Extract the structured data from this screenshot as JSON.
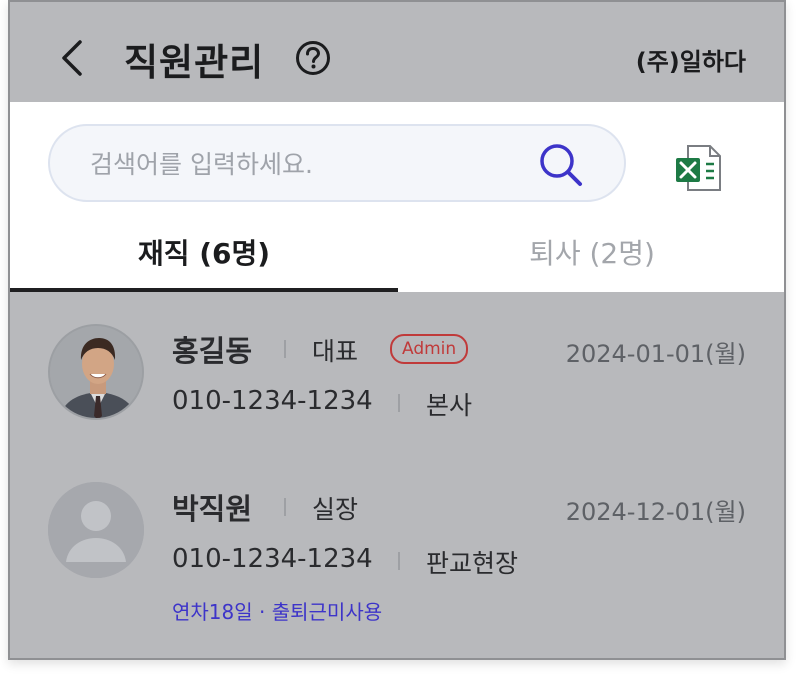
{
  "header": {
    "title": "직원관리",
    "company": "(주)일하다"
  },
  "search": {
    "placeholder": "검색어를 입력하세요."
  },
  "tabs": [
    {
      "label": "재직 (6명)",
      "active": true
    },
    {
      "label": "퇴사 (2명)",
      "active": false
    }
  ],
  "employees": [
    {
      "name": "홍길동",
      "role": "대표",
      "badge": "Admin",
      "date": "2024-01-01(월)",
      "phone": "010-1234-1234",
      "department": "본사",
      "note": ""
    },
    {
      "name": "박직원",
      "role": "실장",
      "badge": "",
      "date": "2024-12-01(월)",
      "phone": "010-1234-1234",
      "department": "판교현장",
      "note": "연차18일 · 출퇴근미사용"
    }
  ],
  "colors": {
    "overlay_gray": "#b8b9bc",
    "accent_blue": "#3d34c9",
    "admin_red": "#c03a3a",
    "excel_green": "#1d7a45"
  }
}
